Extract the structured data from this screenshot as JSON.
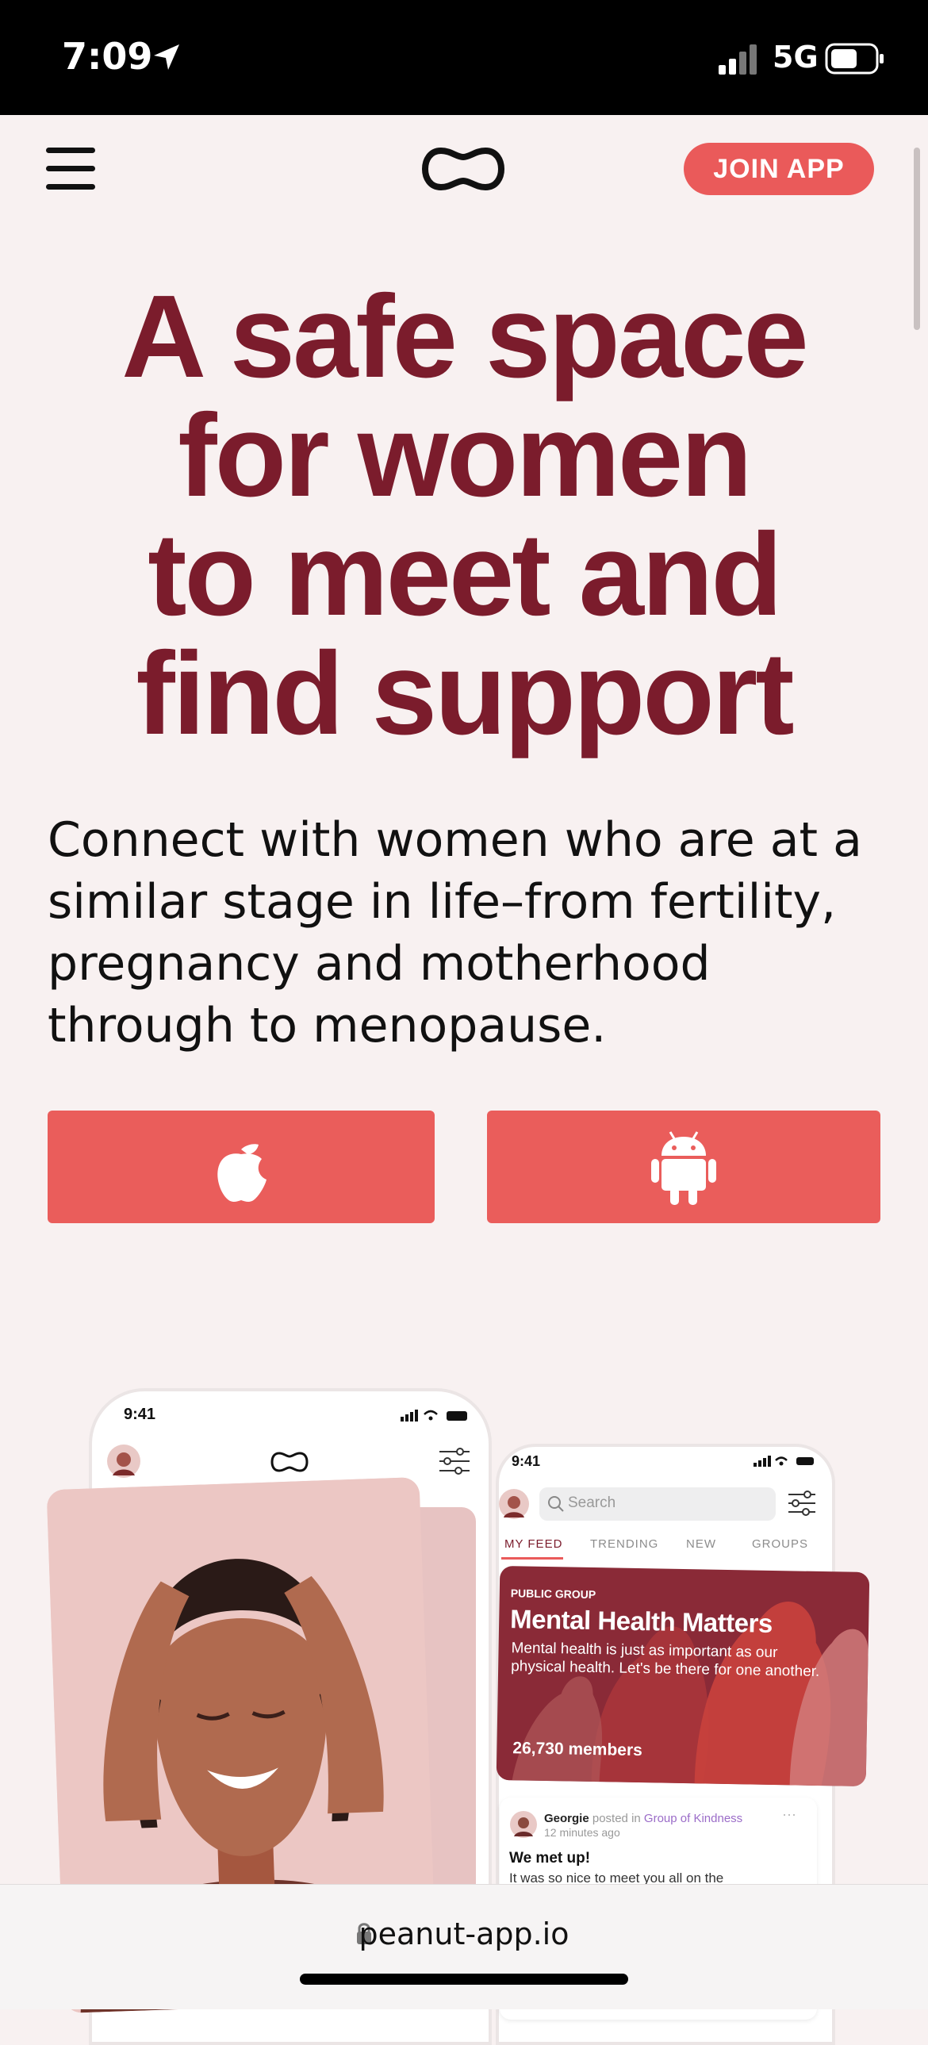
{
  "status_bar": {
    "time": "7:09",
    "network": "5G"
  },
  "header": {
    "join_label": "JOIN APP",
    "logo_icon": "peanut-logo-icon",
    "menu_icon": "hamburger-menu-icon"
  },
  "hero": {
    "headline_lines": [
      "A safe space",
      "for women",
      "to meet and",
      "find support"
    ],
    "subtext_lines": [
      "Connect with women who are at a",
      "similar stage in life–from fertility,",
      "pregnancy and motherhood",
      "through to menopause."
    ]
  },
  "store_buttons": {
    "ios_icon": "apple-icon",
    "android_icon": "android-icon"
  },
  "mockups": {
    "phone1": {
      "time": "9:41"
    },
    "phone2": {
      "time": "9:41",
      "search_placeholder": "Search",
      "tabs": [
        "MY FEED",
        "TRENDING",
        "NEW",
        "GROUPS"
      ],
      "group_card": {
        "tag": "PUBLIC GROUP",
        "title": "Mental Health Matters",
        "description": "Mental health is just as important as our physical health. Let's be there for one another.",
        "members": "26,730 members"
      },
      "post": {
        "author": "Georgie",
        "posted_in": "posted in",
        "group": "Group of Kindness",
        "time": "12 minutes ago",
        "title": "We met up!",
        "body": "It was so nice to meet you all on the"
      }
    }
  },
  "browser": {
    "url": "peanut-app.io"
  },
  "colors": {
    "brand_maroon": "#7b1c2c",
    "brand_coral": "#ea5a5a",
    "background": "#f8f1f1"
  }
}
